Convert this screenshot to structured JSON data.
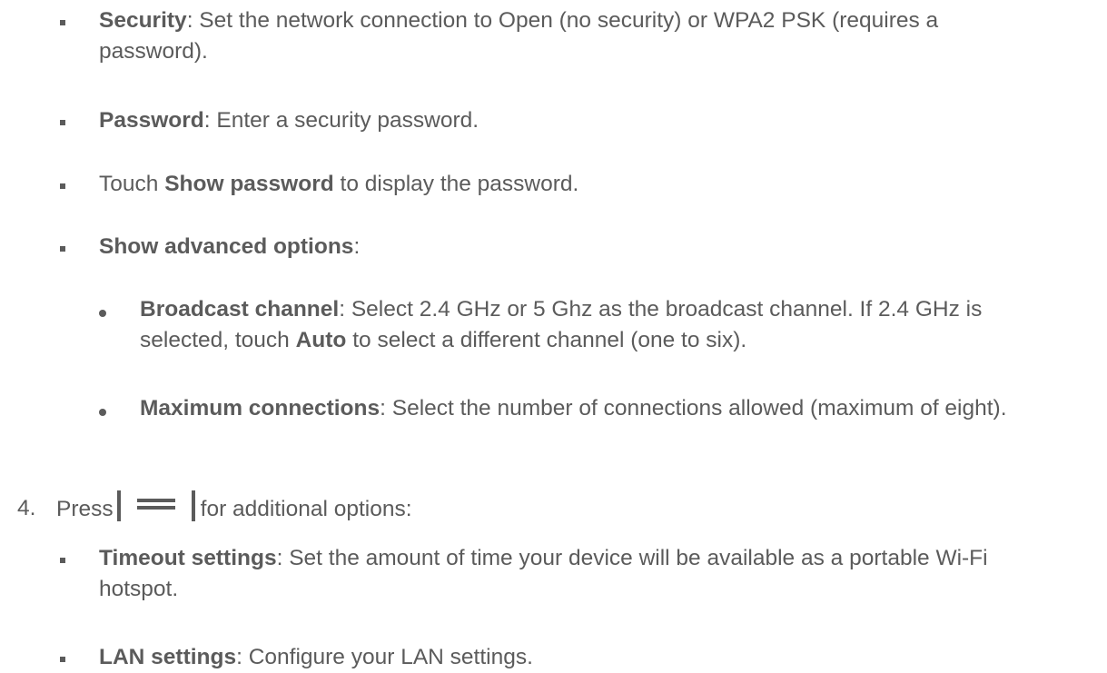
{
  "doc": {
    "items": [
      {
        "bold": "Security",
        "rest": ": Set the network connection to Open (no security) or WPA2 PSK (requires a password)."
      },
      {
        "bold": "Password",
        "rest": ": Enter a security password."
      },
      {
        "pre": "Touch ",
        "bold": "Show password",
        "rest": " to display the password."
      },
      {
        "bold": "Show advanced options",
        "rest": ":"
      },
      {
        "bold": "Broadcast channel",
        "rest1": ": Select 2.4 GHz or 5 Ghz as the broadcast channel. If 2.4 GHz is selected, touch ",
        "bold2": "Auto",
        "rest2": " to select a different channel (one to six)."
      },
      {
        "bold": "Maximum connections",
        "rest": ": Select the number of connections allowed (maximum of eight)."
      },
      {
        "number": "4.",
        "pre": "Press",
        "icon": "menu-icon",
        "rest": "for additional options:"
      },
      {
        "bold": "Timeout settings",
        "rest": ": Set the amount of time your device will be available as a portable Wi-Fi hotspot."
      },
      {
        "bold": "LAN settings",
        "rest": ": Configure your LAN settings."
      }
    ]
  }
}
